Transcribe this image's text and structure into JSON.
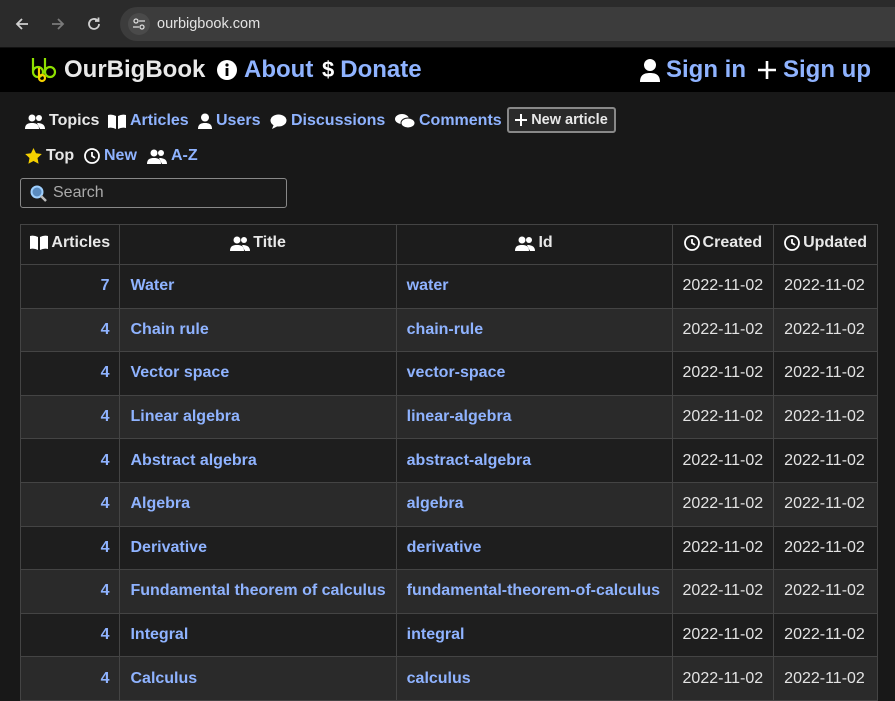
{
  "browser": {
    "url": "ourbigbook.com"
  },
  "header": {
    "brand": "OurBigBook",
    "about": "About",
    "donate": "Donate",
    "sign_in": "Sign in",
    "sign_up": "Sign up"
  },
  "tabs": {
    "topics": "Topics",
    "articles": "Articles",
    "users": "Users",
    "discussions": "Discussions",
    "comments": "Comments",
    "new_article": "New article"
  },
  "sort": {
    "top": "Top",
    "new": "New",
    "az": "A-Z"
  },
  "search": {
    "placeholder": "Search"
  },
  "table": {
    "columns": [
      "Articles",
      "Title",
      "Id",
      "Created",
      "Updated"
    ],
    "rows": [
      {
        "articles": "7",
        "title": "Water",
        "id": "water",
        "created": "2022-11-02",
        "updated": "2022-11-02"
      },
      {
        "articles": "4",
        "title": "Chain rule",
        "id": "chain-rule",
        "created": "2022-11-02",
        "updated": "2022-11-02"
      },
      {
        "articles": "4",
        "title": "Vector space",
        "id": "vector-space",
        "created": "2022-11-02",
        "updated": "2022-11-02"
      },
      {
        "articles": "4",
        "title": "Linear algebra",
        "id": "linear-algebra",
        "created": "2022-11-02",
        "updated": "2022-11-02"
      },
      {
        "articles": "4",
        "title": "Abstract algebra",
        "id": "abstract-algebra",
        "created": "2022-11-02",
        "updated": "2022-11-02"
      },
      {
        "articles": "4",
        "title": "Algebra",
        "id": "algebra",
        "created": "2022-11-02",
        "updated": "2022-11-02"
      },
      {
        "articles": "4",
        "title": "Derivative",
        "id": "derivative",
        "created": "2022-11-02",
        "updated": "2022-11-02"
      },
      {
        "articles": "4",
        "title": "Fundamental theorem of calculus",
        "id": "fundamental-theorem-of-calculus",
        "created": "2022-11-02",
        "updated": "2022-11-02"
      },
      {
        "articles": "4",
        "title": "Integral",
        "id": "integral",
        "created": "2022-11-02",
        "updated": "2022-11-02"
      },
      {
        "articles": "4",
        "title": "Calculus",
        "id": "calculus",
        "created": "2022-11-02",
        "updated": "2022-11-02"
      }
    ]
  },
  "colors": {
    "link": "#8fb3ff",
    "logo_green": "#8ee000",
    "star": "#f5d000"
  }
}
